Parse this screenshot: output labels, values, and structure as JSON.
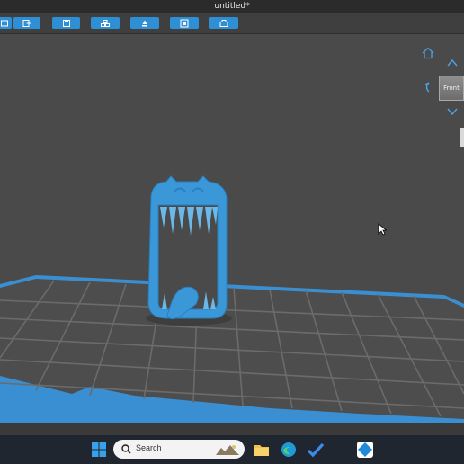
{
  "window": {
    "title": "untitled*"
  },
  "toolbar": {
    "buttons": [
      {
        "name": "open-file-button",
        "icon": "folder-open-icon"
      },
      {
        "name": "import-button",
        "icon": "import-icon"
      },
      {
        "name": "save-button",
        "icon": "save-icon"
      },
      {
        "name": "arrange-button",
        "icon": "arrange-icon"
      },
      {
        "name": "support-button",
        "icon": "support-icon"
      },
      {
        "name": "frame-button",
        "icon": "frame-icon"
      },
      {
        "name": "slice-button",
        "icon": "slice-icon"
      }
    ]
  },
  "viewport": {
    "model_color": "#3a98d8",
    "grid_color": "#6b6b6b",
    "plate_edge_color": "#3a8fd2",
    "nav_cube": {
      "face_label": "Front"
    },
    "nav_icons": [
      "home-icon",
      "rotate-up-icon",
      "rotate-left-icon",
      "rotate-down-icon"
    ]
  },
  "taskbar": {
    "search_placeholder": "Search",
    "icons": [
      "windows-start-icon",
      "search-icon",
      "file-explorer-icon",
      "edge-browser-icon",
      "todo-icon",
      "slicer-app-icon"
    ]
  },
  "colors": {
    "accent": "#2f8fd4",
    "background": "#4a4a4a",
    "taskbar": "#1f2630"
  }
}
